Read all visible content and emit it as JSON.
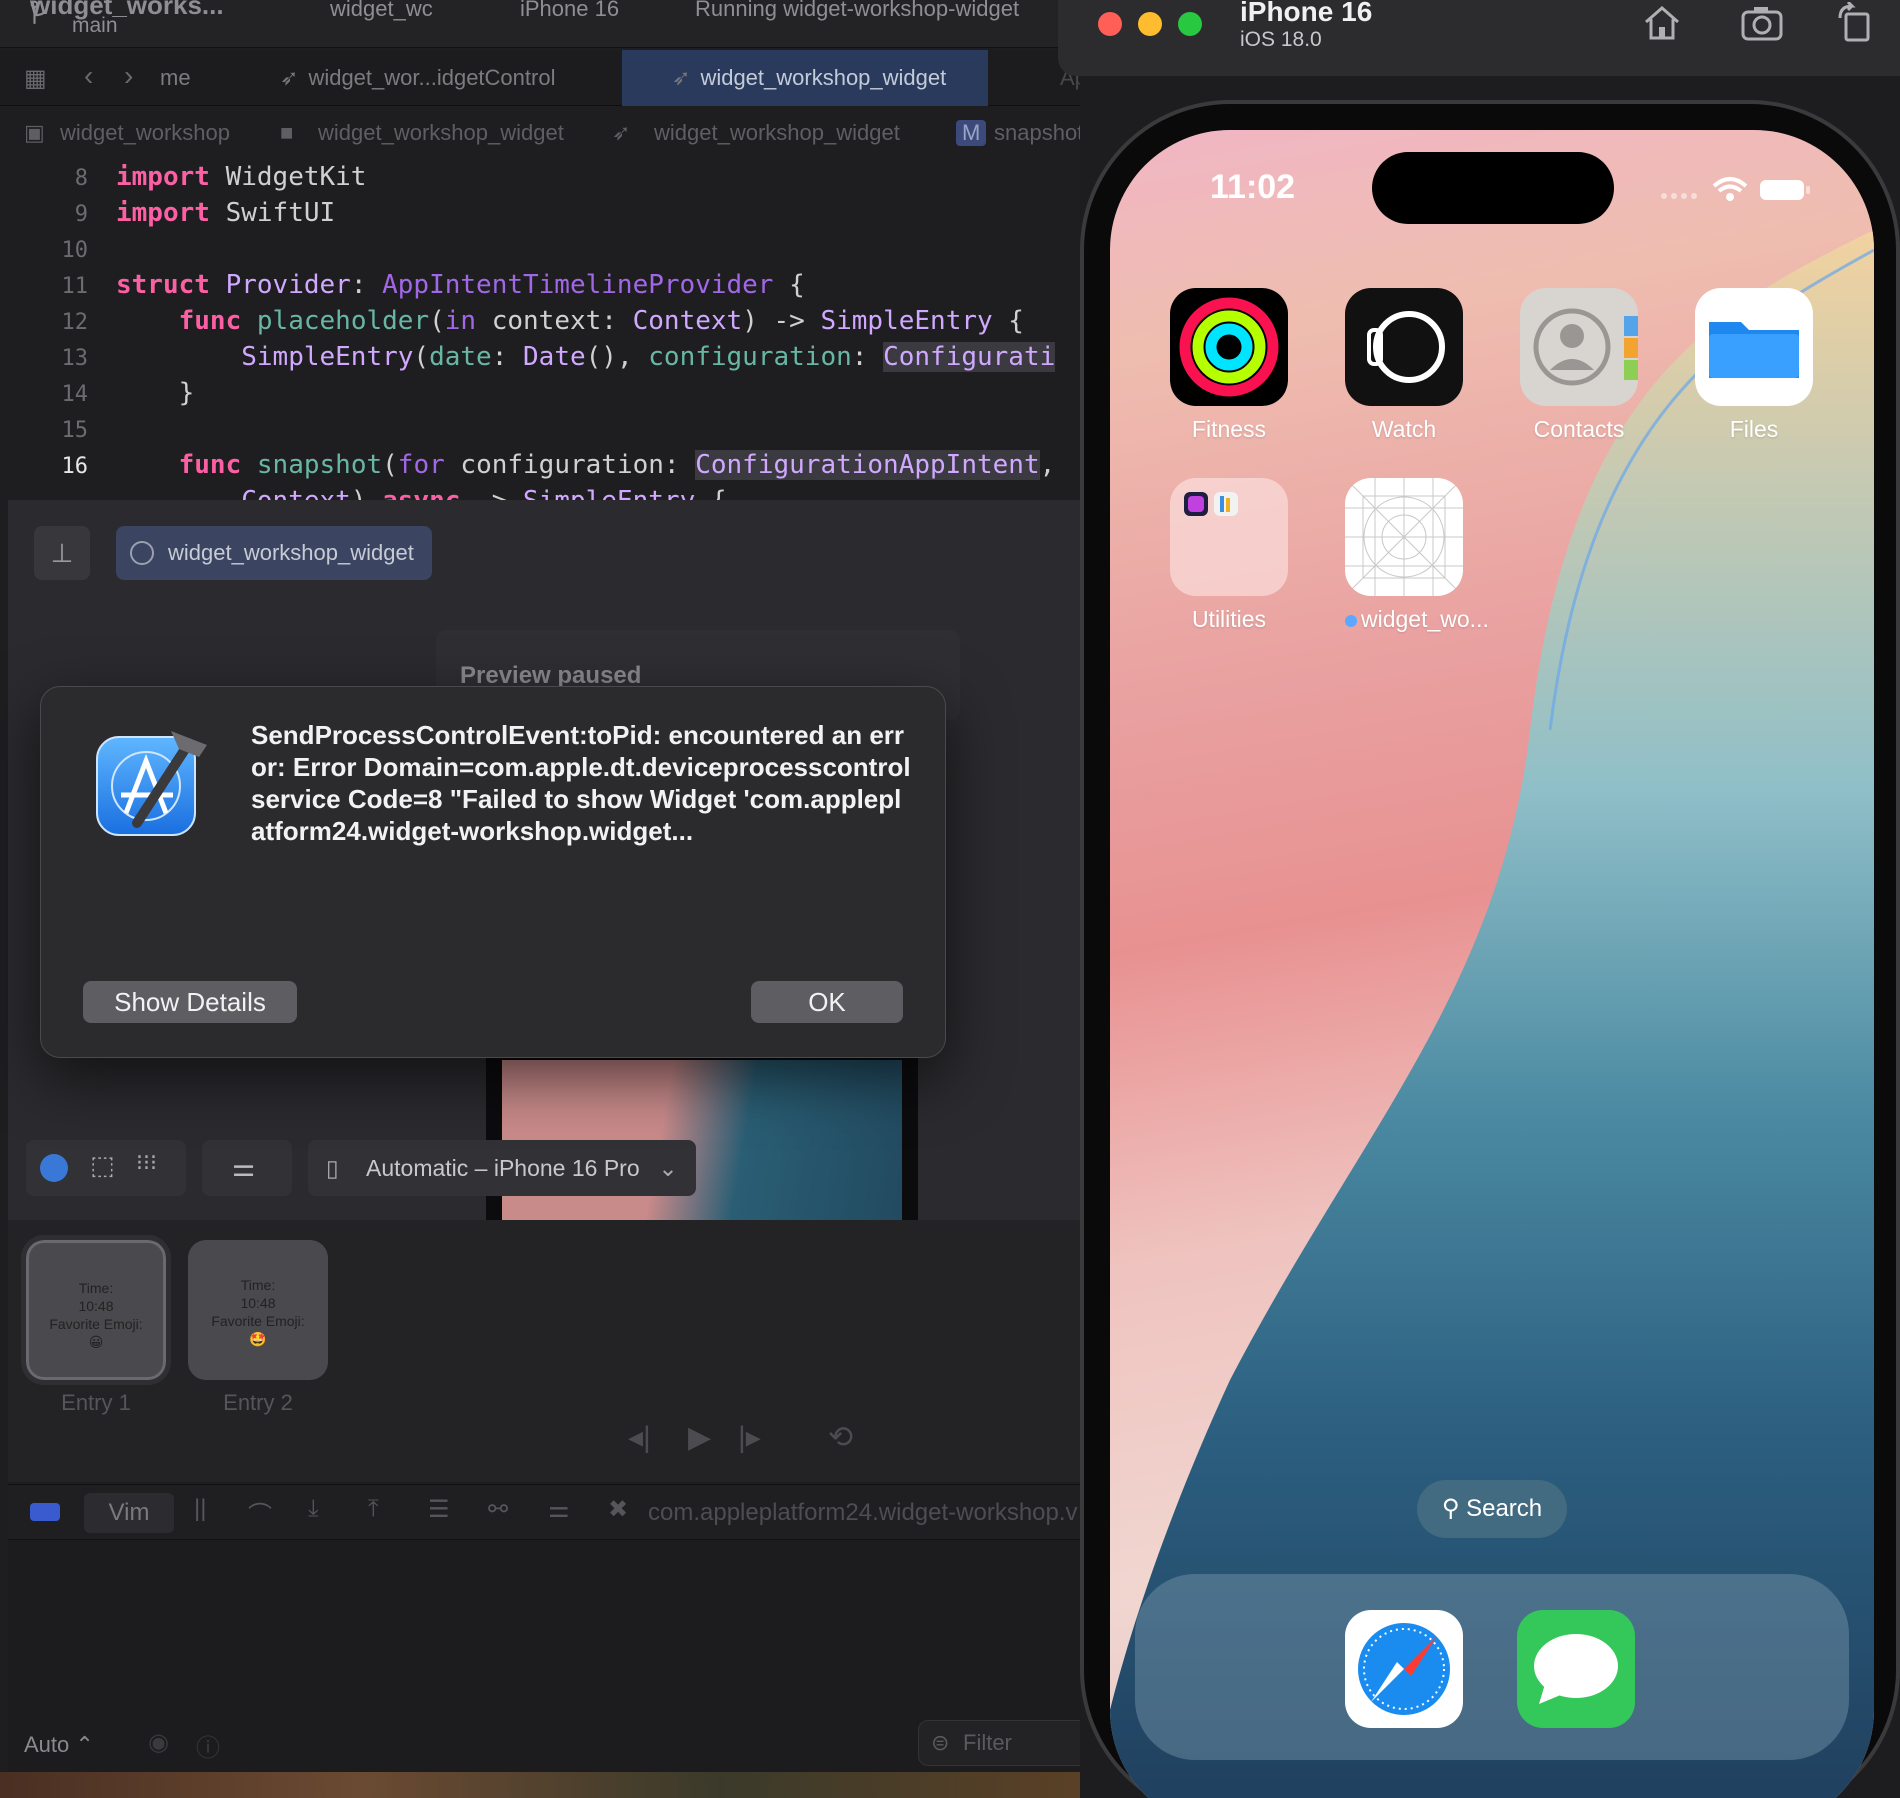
{
  "xcode": {
    "toolbar": {
      "project": "widget_works...",
      "branch": "main",
      "scheme": "widget_wc",
      "destination": "iPhone 16",
      "status": "Running widget-workshop-widget"
    },
    "tabs": [
      {
        "label": "me"
      },
      {
        "label": "widget_wor...idgetControl"
      },
      {
        "label": "widget_workshop_widget"
      },
      {
        "label": "AppIntent"
      }
    ],
    "breadcrumbs": [
      "widget_workshop",
      "widget_workshop_widget",
      "widget_workshop_widget",
      "snapshot(fo"
    ],
    "code": [
      {
        "num": "8",
        "text": "import WidgetKit"
      },
      {
        "num": "9",
        "text": "import SwiftUI"
      },
      {
        "num": "10",
        "text": ""
      },
      {
        "num": "11",
        "text": "struct Provider: AppIntentTimelineProvider {"
      },
      {
        "num": "12",
        "text": "    func placeholder(in context: Context) -> SimpleEntry {"
      },
      {
        "num": "13",
        "text": "        SimpleEntry(date: Date(), configuration: Configurati"
      },
      {
        "num": "14",
        "text": "    }"
      },
      {
        "num": "15",
        "text": ""
      },
      {
        "num": "16",
        "text": "    func snapshot(for configuration: ConfigurationAppIntent,"
      },
      {
        "num": "",
        "text": "        Context) async -> SimpleEntry {"
      }
    ],
    "preview": {
      "chip_label": "widget_workshop_widget",
      "paused_label": "Preview paused",
      "device_label": "Automatic – iPhone 16 Pro"
    },
    "entries": [
      {
        "label": "Entry 1",
        "line1": "Time:",
        "line2": "10:48",
        "line3": "Favorite Emoji:",
        "emoji": "😀"
      },
      {
        "label": "Entry 2",
        "line1": "Time:",
        "line2": "10:48",
        "line3": "Favorite Emoji:",
        "emoji": "🤩"
      }
    ],
    "debug": {
      "vim_label": "Vim",
      "bundle": "com.appleplatform24.widget-workshop.v"
    },
    "console": {
      "auto_label": "Auto ⌃",
      "filter_placeholder": "Filter"
    }
  },
  "alert": {
    "message": "SendProcessControlEvent:toPid: encountered an error: Error Domain=com.apple.dt.deviceprocesscontrolservice Code=8 \"Failed to show Widget 'com.appleplatform24.widget-workshop.widget...",
    "show_details_label": "Show Details",
    "ok_label": "OK",
    "icon": "xcode-hammer-icon"
  },
  "simulator": {
    "device_name": "iPhone 16",
    "os_version": "iOS 18.0",
    "toolbar_icons": [
      "home-icon",
      "screenshot-icon",
      "rotate-icon"
    ],
    "traffic_colors": [
      "#ff5f57",
      "#febc2e",
      "#28c840"
    ],
    "clock": "11:02",
    "apps": [
      {
        "name": "Fitness",
        "icon": "fitness-rings-icon"
      },
      {
        "name": "Watch",
        "icon": "watch-icon"
      },
      {
        "name": "Contacts",
        "icon": "contacts-icon"
      },
      {
        "name": "Files",
        "icon": "files-folder-icon"
      },
      {
        "name": "Utilities",
        "icon": "utilities-folder-icon"
      },
      {
        "name": "widget_wo...",
        "icon": "placeholder-app-icon"
      }
    ],
    "search_label": "Search",
    "dock": [
      {
        "name": "Safari",
        "icon": "safari-compass-icon"
      },
      {
        "name": "Messages",
        "icon": "messages-bubble-icon"
      }
    ]
  }
}
